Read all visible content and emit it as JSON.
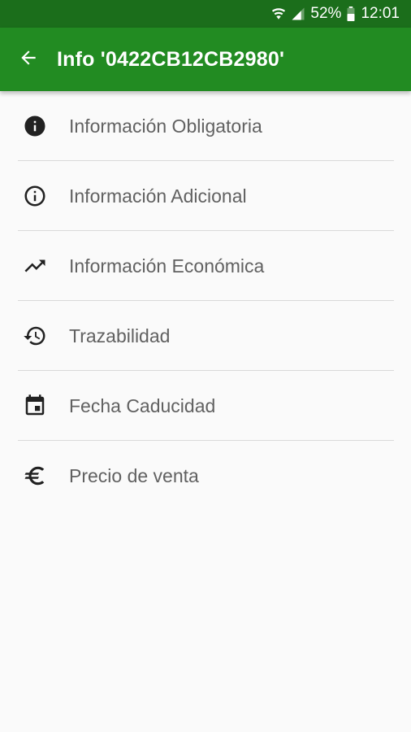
{
  "status_bar": {
    "battery": "52%",
    "time": "12:01",
    "icons": [
      "wifi-icon",
      "signal-icon",
      "battery-icon"
    ]
  },
  "app_bar": {
    "title": "Info '0422CB12CB2980'",
    "back_icon": "arrow-back-icon",
    "color": "#228b22"
  },
  "menu": {
    "items": [
      {
        "label": "Información Obligatoria",
        "icon": "info-filled-icon"
      },
      {
        "label": "Información Adicional",
        "icon": "info-outline-icon"
      },
      {
        "label": "Información Económica",
        "icon": "trending-up-icon"
      },
      {
        "label": "Trazabilidad",
        "icon": "history-icon"
      },
      {
        "label": "Fecha Caducidad",
        "icon": "calendar-event-icon"
      },
      {
        "label": "Precio de venta",
        "icon": "euro-icon"
      }
    ]
  }
}
